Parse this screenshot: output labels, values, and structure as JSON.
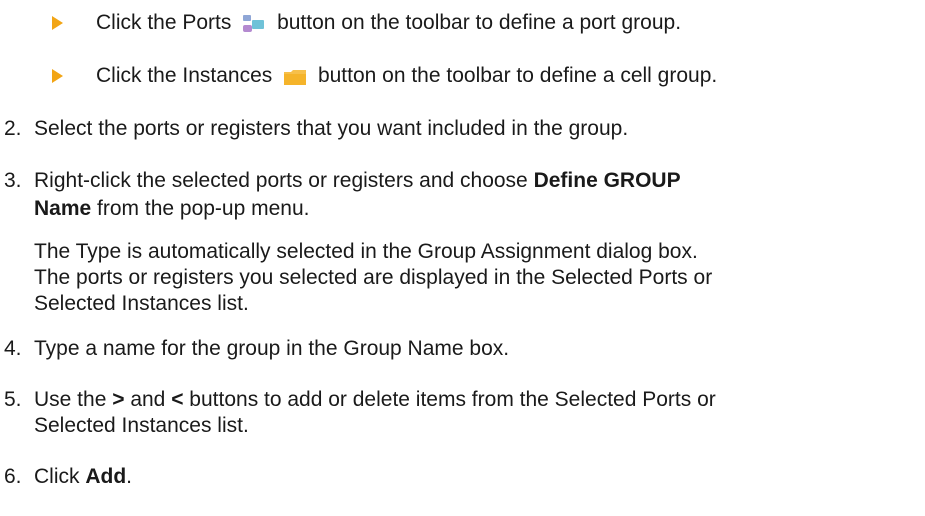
{
  "bullets": [
    {
      "before": "Click the Ports",
      "icon": "ports-icon",
      "after": "button on the toolbar to define a port group."
    },
    {
      "before": "Click the Instances",
      "icon": "instances-icon",
      "after": "button on the toolbar to define a cell group."
    }
  ],
  "steps": [
    {
      "number": "2.",
      "lines": [
        "Select the ports or registers that you want included in the group."
      ]
    },
    {
      "number": "3.",
      "line1": "Right-click the selected ports or registers and choose ",
      "bold1": "Define GROUP",
      "bold2": "Name",
      "line2_rest": " from the pop-up menu.",
      "para": [
        "The Type is automatically selected in the Group Assignment dialog box.",
        "The ports or registers you selected are displayed in the Selected Ports or",
        "Selected Instances list."
      ]
    },
    {
      "number": "4.",
      "lines": [
        "Type a name for the group in the Group Name box."
      ]
    },
    {
      "number": "5.",
      "pre": "Use the ",
      "gt": ">",
      "mid": " and ",
      "lt": "<",
      "post": " buttons to add or delete items from the Selected Ports or",
      "line2": "Selected Instances list."
    },
    {
      "number": "6.",
      "pre": "Click ",
      "bold": "Add",
      "post": "."
    }
  ],
  "colors": {
    "bullet": "#f2a515",
    "text": "#1a1a1a"
  }
}
